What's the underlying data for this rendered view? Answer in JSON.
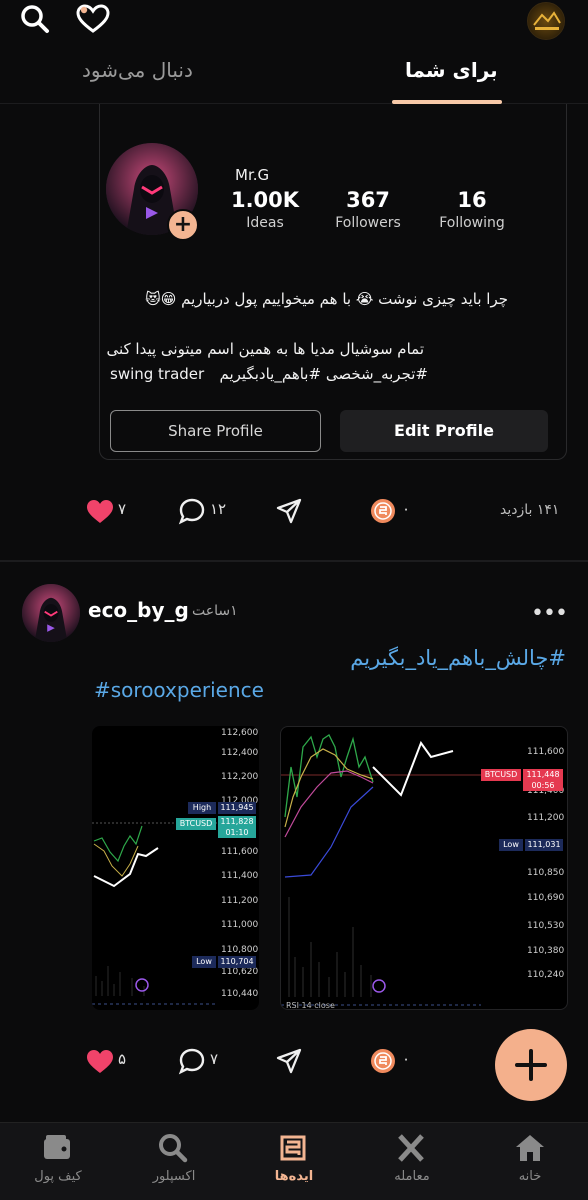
{
  "header": {
    "tabs": [
      {
        "label": "دنبال می‌شود",
        "active": false
      },
      {
        "label": "برای شما",
        "active": true
      }
    ],
    "icons": [
      "search-icon",
      "heart-pulse-icon",
      "brand-logo"
    ],
    "accent_color": "#f3b592"
  },
  "profile": {
    "username": "Mr.G",
    "stats": [
      {
        "value": "1.00K",
        "label": "Ideas"
      },
      {
        "value": "367",
        "label": "Followers"
      },
      {
        "value": "16",
        "label": "Following"
      }
    ],
    "bio_line_1": "چرا باید چیزی نوشت 😭 با هم میخواییم پول دربیاریم 😁😻",
    "bio_line_2": "تمام سوشیال مدیا ها به همین اسم میتونی پیدا کنی",
    "bio_line_3": "#تجربه_شخصی #باهم_یادبگیریم",
    "bio_line_3_latin": "swing trader",
    "share_label": "Share Profile",
    "edit_label": "Edit Profile"
  },
  "profile_actions": {
    "likes": "۷",
    "comments": "۱۲",
    "boosts": "۰",
    "views": "۱۴۱ بازدید"
  },
  "post": {
    "author": "eco_by_g",
    "time": "۱ساعت",
    "hashtag_1": "#چالش_باهم_یاد_بگیریم",
    "hashtag_2": "#sorooxperience",
    "likes": "۵",
    "comments": "۷",
    "boosts": "۰"
  },
  "chart_1": {
    "ticks": [
      "112,600",
      "112,400",
      "112,200",
      "112,000",
      "111,600",
      "111,400",
      "111,200",
      "111,000",
      "110,800",
      "110,620",
      "110,440"
    ],
    "high_label": "High",
    "high_value": "111,945",
    "symbol": "BTCUSD",
    "price": "111,828",
    "timer": "01:10",
    "low_label": "Low",
    "low_value": "110,704"
  },
  "chart_2": {
    "ticks": [
      "111,600",
      "111,400",
      "111,200",
      "110,850",
      "110,690",
      "110,530",
      "110,380",
      "110,240"
    ],
    "symbol": "BTCUSD",
    "price": "111,448",
    "timer": "00:56",
    "low_label": "Low",
    "low_value": "111,031",
    "indicator": "RSI 14 close"
  },
  "nav": {
    "items": [
      {
        "label": "کیف پول",
        "icon": "wallet-icon"
      },
      {
        "label": "اکسپلور",
        "icon": "search-icon"
      },
      {
        "label": "ایده‌ها",
        "icon": "ideas-icon",
        "active": true
      },
      {
        "label": "معامله",
        "icon": "trade-x-icon"
      },
      {
        "label": "خانه",
        "icon": "home-icon"
      }
    ]
  }
}
